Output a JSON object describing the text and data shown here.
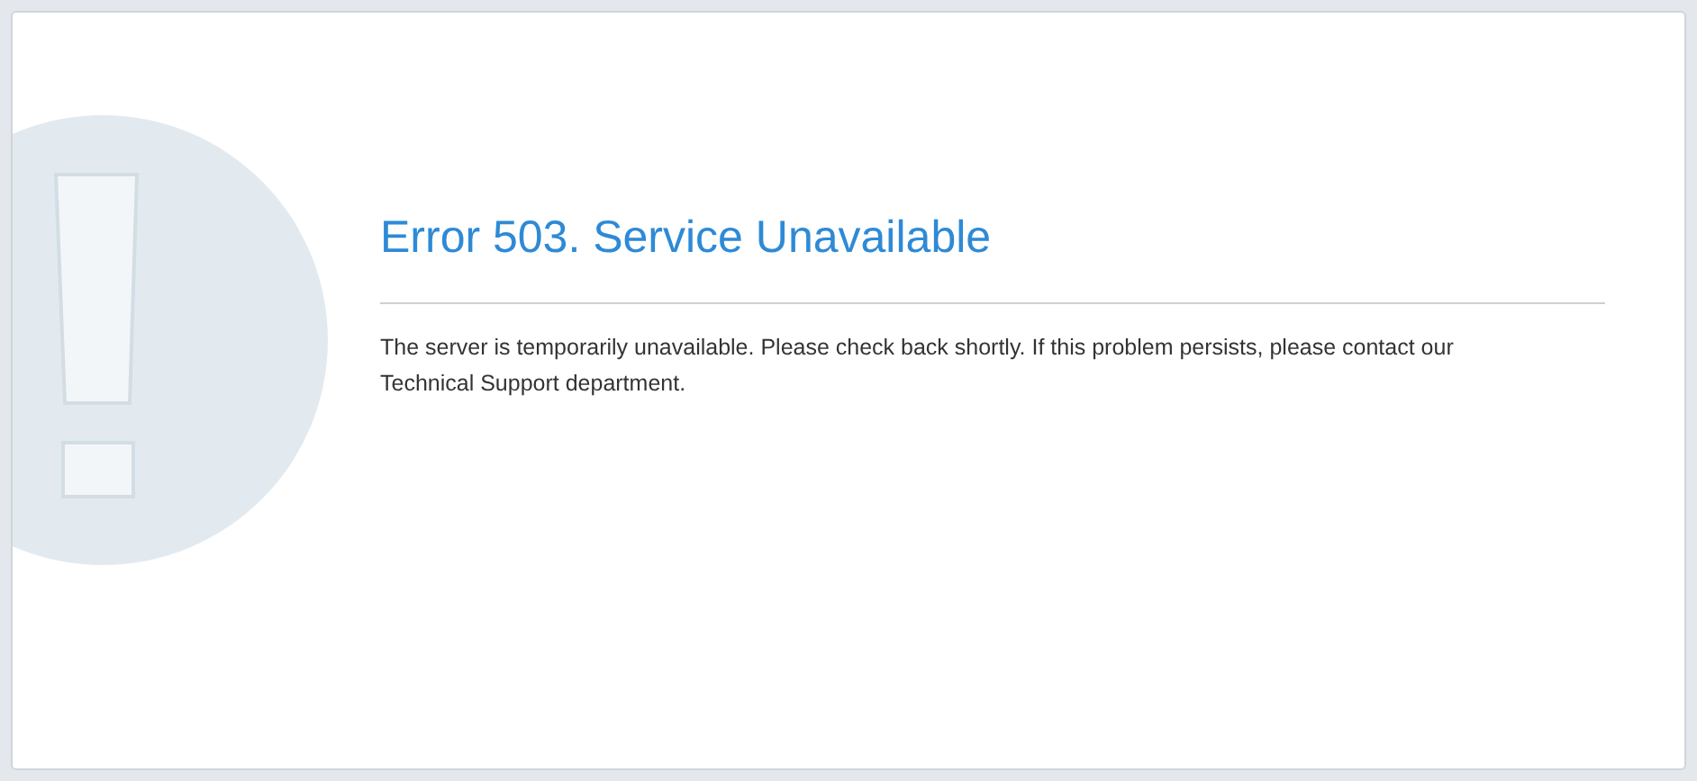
{
  "error": {
    "title": "Error 503. Service Unavailable",
    "message": "The server is temporarily unavailable. Please check back shortly. If this problem persists, please contact our Technical Support department."
  }
}
